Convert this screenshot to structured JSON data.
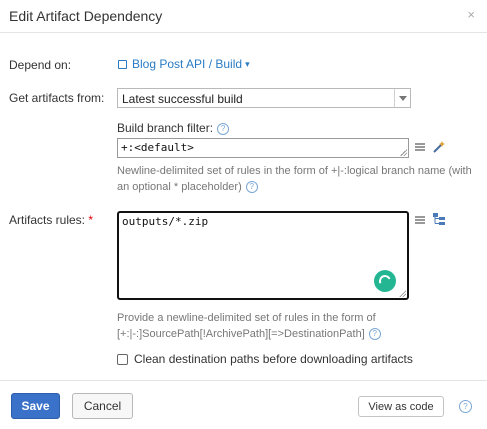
{
  "dialog": {
    "title": "Edit Artifact Dependency",
    "close_glyph": "×"
  },
  "depend_on": {
    "label": "Depend on:",
    "value": "Blog Post API / Build"
  },
  "get_artifacts": {
    "label": "Get artifacts from:",
    "selected": "Latest successful build"
  },
  "branch_filter": {
    "label": "Build branch filter:",
    "value": "+:<default>",
    "note": "Newline-delimited set of rules in the form of +|-:logical branch name (with an optional * placeholder)"
  },
  "artifacts_rules": {
    "label": "Artifacts rules:",
    "required_mark": "*",
    "value": "outputs/*.zip",
    "note_line1": "Provide a newline-delimited set of rules in the form of",
    "note_line2": "[+:|-:]SourcePath[!ArchivePath][=>DestinationPath]"
  },
  "clean_destination": {
    "label": "Clean destination paths before downloading artifacts",
    "checked": false
  },
  "footer": {
    "save": "Save",
    "cancel": "Cancel",
    "view_as_code": "View as code"
  },
  "colors": {
    "link": "#2a7bc4",
    "primary": "#3a72c9",
    "spinner": "#24b592",
    "required": "#dd0000"
  }
}
